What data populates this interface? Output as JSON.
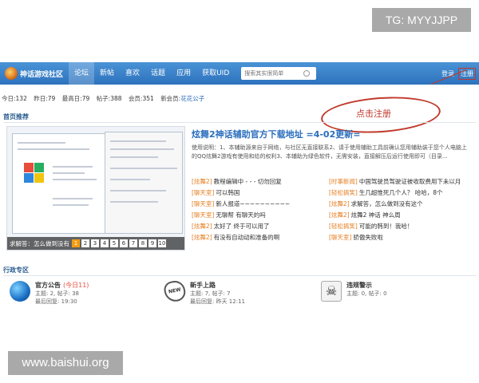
{
  "watermarks": {
    "tg": "TG: MYYJJPP",
    "site": "www.baishui.org"
  },
  "navbar": {
    "logo": "神话游戏社区",
    "items": [
      "论坛",
      "新帖",
      "喜欢",
      "话题",
      "应用",
      "获取UID"
    ],
    "active_index": 0,
    "search_placeholder": "搜索其实很简单",
    "login": "登录",
    "register": "注册"
  },
  "stats": {
    "today_label": "今日:",
    "today": "132",
    "yesterday_label": "昨日:",
    "yesterday": "79",
    "max_label": "最高日:",
    "max": "79",
    "posts_label": "帖子:",
    "posts": "388",
    "members_label": "会员:",
    "members": "351",
    "newest_label": "新会员:",
    "newest": "花花公子"
  },
  "annotation": {
    "text": "点击注册"
  },
  "recommend": {
    "title": "首页推荐",
    "caption": "求解答：怎么做到没有",
    "pages": [
      "1",
      "2",
      "3",
      "4",
      "5",
      "6",
      "7",
      "8",
      "9",
      "10"
    ],
    "active_page": "1",
    "headline": "炫舞2神话辅助官方下载地址 =4-02更新=",
    "summary": "使用说明：1、本辅助源来自于网络，与社区无直接联系2、请于使用辅助工具前确认您用辅助装于您个人电脑上的QQ炫舞2游戏有使用和给的权利3、本辅助为绿色软件，无需安装，直接解压后运行使用即可（目录...",
    "threads": [
      {
        "tag": "[炫舞2]",
        "title": "教程编辑中 - - - 切勿回复"
      },
      {
        "tag": "[时事新闻]",
        "title": "中国驾驶员驾驶证被收取费用下未以月"
      },
      {
        "tag": "[聊天室]",
        "title": "可以韩国"
      },
      {
        "tag": "[轻松搞笑]",
        "title": "生几超惟死几个人？ 哈哈，8个"
      },
      {
        "tag": "[聊天室]",
        "title": "新人报道~~~~~~~~~~"
      },
      {
        "tag": "[炫舞2]",
        "title": "求解答，怎么做到没有这个"
      },
      {
        "tag": "[聊天室]",
        "title": "无聊帮 有聊天的吗"
      },
      {
        "tag": "[炫舞2]",
        "title": "炫舞2 神话 神么周"
      },
      {
        "tag": "[炫舞2]",
        "title": "太好了 终于可以用了"
      },
      {
        "tag": "[轻松搞笑]",
        "title": "可能的韩到！我哈！"
      },
      {
        "tag": "[炫舞2]",
        "title": "有没有自动动和准备的啊"
      },
      {
        "tag": "[聊天室]",
        "title": "骄傲失败啦"
      }
    ]
  },
  "zone": {
    "title": "行政专区",
    "forums": [
      {
        "name": "官方公告",
        "today": "(今日11)",
        "line1": "主题: 2, 帖子: 38",
        "line2": "最后回复: 19:30",
        "icon": "globe-icon"
      },
      {
        "name": "新手上路",
        "today": "",
        "line1": "主题: 7, 帖子: 7",
        "line2": "最后回复: 昨天 12:11",
        "icon": "new-sticker-icon"
      },
      {
        "name": "违规警示",
        "today": "",
        "line1": "主题: 0, 帖子: 0",
        "line2": "",
        "icon": "skull-icon"
      }
    ]
  }
}
